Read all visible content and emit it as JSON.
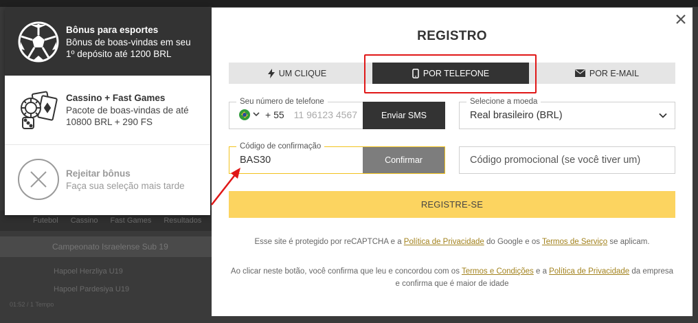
{
  "background": {
    "nav_items": [
      "Futebol",
      "Cassino",
      "Fast Games",
      "Resultados"
    ],
    "league": "Campeonato Israelense Sub 19",
    "team1": "Hapoel Herzliya U19",
    "team2": "Hapoel Pardesiya U19",
    "match_time": "01:52 / 1 Tempo"
  },
  "bonus": {
    "sports_title": "Bônus para esportes",
    "sports_desc": "Bônus de boas-vindas em seu 1º depósito até 1200 BRL",
    "casino_title": "Cassino + Fast Games",
    "casino_desc": "Pacote de boas-vindas de até 10800 BRL + 290 FS",
    "reject_title": "Rejeitar bônus",
    "reject_desc": "Faça sua seleção mais tarde"
  },
  "modal": {
    "title": "REGISTRO",
    "tabs": [
      "UM CLIQUE",
      "POR TELEFONE",
      "POR E-MAIL"
    ],
    "active_tab": "POR TELEFONE",
    "phone_label": "Seu número de telefone",
    "dial_code": "+ 55",
    "phone_placeholder": "11 96123 4567",
    "sms_button": "Enviar SMS",
    "currency_label": "Selecione a moeda",
    "currency_value": "Real brasileiro (BRL)",
    "code_label": "Código de confirmação",
    "code_value": "BAS30",
    "confirm_button": "Confirmar",
    "promo_placeholder": "Código promocional (se você tiver um)",
    "register_button": "REGISTRE-SE",
    "legal1_pre": "Esse site é protegido por reCAPTCHA e a ",
    "legal1_link1": "Política de Privacidade",
    "legal1_mid": " do Google e os ",
    "legal1_link2": "Termos de Serviço",
    "legal1_post": " se aplicam.",
    "legal2_pre": "Ao clicar neste botão, você confirma que leu e concordou com os ",
    "legal2_link1": "Termos e Condições",
    "legal2_mid": " e a ",
    "legal2_link2": "Política de Privacidade",
    "legal2_post": " da empresa e confirma que é maior de idade"
  },
  "colors": {
    "accent_yellow": "#fcd460",
    "dark": "#333333",
    "highlight_red": "#e01717",
    "link": "#a2821d"
  }
}
